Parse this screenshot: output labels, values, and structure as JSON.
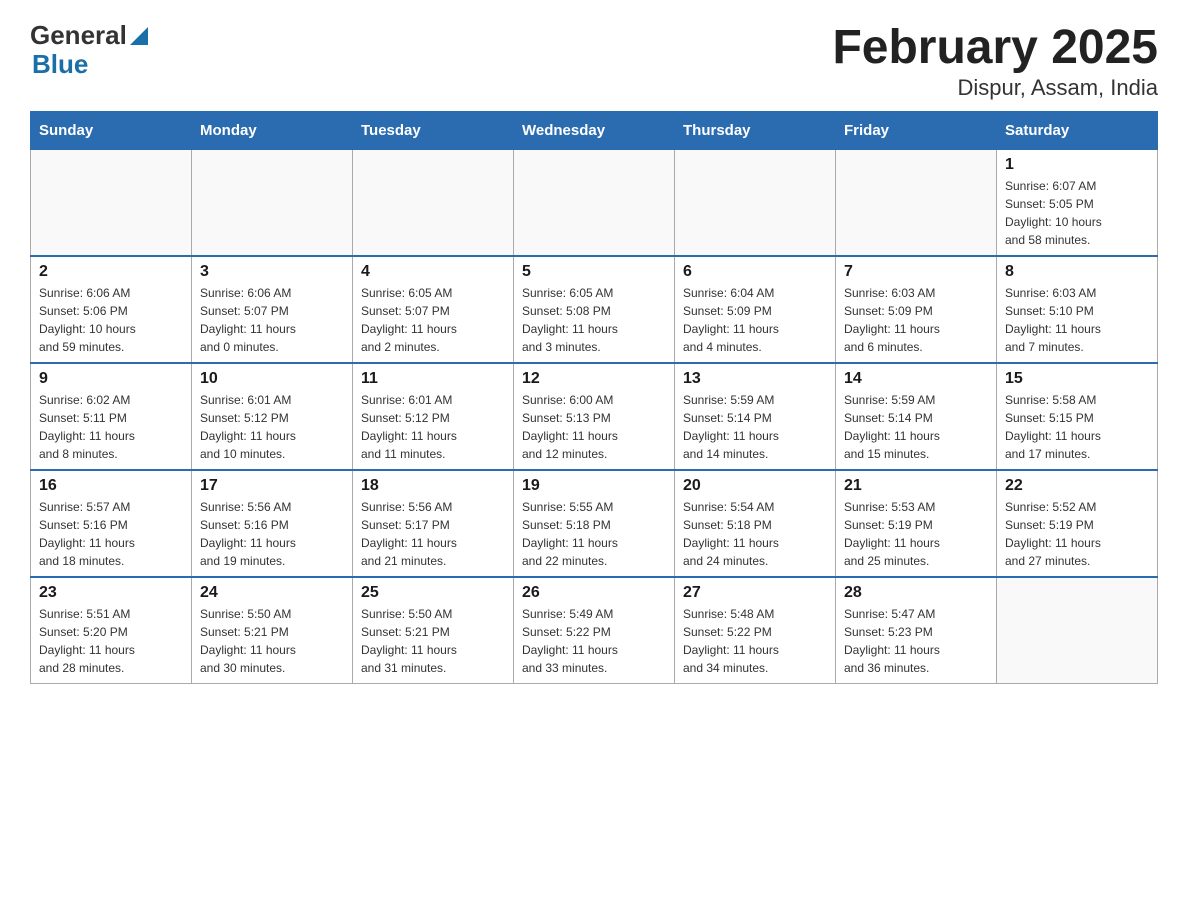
{
  "header": {
    "title": "February 2025",
    "subtitle": "Dispur, Assam, India",
    "logo": {
      "general": "General",
      "blue": "Blue"
    }
  },
  "weekdays": [
    "Sunday",
    "Monday",
    "Tuesday",
    "Wednesday",
    "Thursday",
    "Friday",
    "Saturday"
  ],
  "weeks": [
    [
      {
        "day": "",
        "info": ""
      },
      {
        "day": "",
        "info": ""
      },
      {
        "day": "",
        "info": ""
      },
      {
        "day": "",
        "info": ""
      },
      {
        "day": "",
        "info": ""
      },
      {
        "day": "",
        "info": ""
      },
      {
        "day": "1",
        "info": "Sunrise: 6:07 AM\nSunset: 5:05 PM\nDaylight: 10 hours\nand 58 minutes."
      }
    ],
    [
      {
        "day": "2",
        "info": "Sunrise: 6:06 AM\nSunset: 5:06 PM\nDaylight: 10 hours\nand 59 minutes."
      },
      {
        "day": "3",
        "info": "Sunrise: 6:06 AM\nSunset: 5:07 PM\nDaylight: 11 hours\nand 0 minutes."
      },
      {
        "day": "4",
        "info": "Sunrise: 6:05 AM\nSunset: 5:07 PM\nDaylight: 11 hours\nand 2 minutes."
      },
      {
        "day": "5",
        "info": "Sunrise: 6:05 AM\nSunset: 5:08 PM\nDaylight: 11 hours\nand 3 minutes."
      },
      {
        "day": "6",
        "info": "Sunrise: 6:04 AM\nSunset: 5:09 PM\nDaylight: 11 hours\nand 4 minutes."
      },
      {
        "day": "7",
        "info": "Sunrise: 6:03 AM\nSunset: 5:09 PM\nDaylight: 11 hours\nand 6 minutes."
      },
      {
        "day": "8",
        "info": "Sunrise: 6:03 AM\nSunset: 5:10 PM\nDaylight: 11 hours\nand 7 minutes."
      }
    ],
    [
      {
        "day": "9",
        "info": "Sunrise: 6:02 AM\nSunset: 5:11 PM\nDaylight: 11 hours\nand 8 minutes."
      },
      {
        "day": "10",
        "info": "Sunrise: 6:01 AM\nSunset: 5:12 PM\nDaylight: 11 hours\nand 10 minutes."
      },
      {
        "day": "11",
        "info": "Sunrise: 6:01 AM\nSunset: 5:12 PM\nDaylight: 11 hours\nand 11 minutes."
      },
      {
        "day": "12",
        "info": "Sunrise: 6:00 AM\nSunset: 5:13 PM\nDaylight: 11 hours\nand 12 minutes."
      },
      {
        "day": "13",
        "info": "Sunrise: 5:59 AM\nSunset: 5:14 PM\nDaylight: 11 hours\nand 14 minutes."
      },
      {
        "day": "14",
        "info": "Sunrise: 5:59 AM\nSunset: 5:14 PM\nDaylight: 11 hours\nand 15 minutes."
      },
      {
        "day": "15",
        "info": "Sunrise: 5:58 AM\nSunset: 5:15 PM\nDaylight: 11 hours\nand 17 minutes."
      }
    ],
    [
      {
        "day": "16",
        "info": "Sunrise: 5:57 AM\nSunset: 5:16 PM\nDaylight: 11 hours\nand 18 minutes."
      },
      {
        "day": "17",
        "info": "Sunrise: 5:56 AM\nSunset: 5:16 PM\nDaylight: 11 hours\nand 19 minutes."
      },
      {
        "day": "18",
        "info": "Sunrise: 5:56 AM\nSunset: 5:17 PM\nDaylight: 11 hours\nand 21 minutes."
      },
      {
        "day": "19",
        "info": "Sunrise: 5:55 AM\nSunset: 5:18 PM\nDaylight: 11 hours\nand 22 minutes."
      },
      {
        "day": "20",
        "info": "Sunrise: 5:54 AM\nSunset: 5:18 PM\nDaylight: 11 hours\nand 24 minutes."
      },
      {
        "day": "21",
        "info": "Sunrise: 5:53 AM\nSunset: 5:19 PM\nDaylight: 11 hours\nand 25 minutes."
      },
      {
        "day": "22",
        "info": "Sunrise: 5:52 AM\nSunset: 5:19 PM\nDaylight: 11 hours\nand 27 minutes."
      }
    ],
    [
      {
        "day": "23",
        "info": "Sunrise: 5:51 AM\nSunset: 5:20 PM\nDaylight: 11 hours\nand 28 minutes."
      },
      {
        "day": "24",
        "info": "Sunrise: 5:50 AM\nSunset: 5:21 PM\nDaylight: 11 hours\nand 30 minutes."
      },
      {
        "day": "25",
        "info": "Sunrise: 5:50 AM\nSunset: 5:21 PM\nDaylight: 11 hours\nand 31 minutes."
      },
      {
        "day": "26",
        "info": "Sunrise: 5:49 AM\nSunset: 5:22 PM\nDaylight: 11 hours\nand 33 minutes."
      },
      {
        "day": "27",
        "info": "Sunrise: 5:48 AM\nSunset: 5:22 PM\nDaylight: 11 hours\nand 34 minutes."
      },
      {
        "day": "28",
        "info": "Sunrise: 5:47 AM\nSunset: 5:23 PM\nDaylight: 11 hours\nand 36 minutes."
      },
      {
        "day": "",
        "info": ""
      }
    ]
  ]
}
